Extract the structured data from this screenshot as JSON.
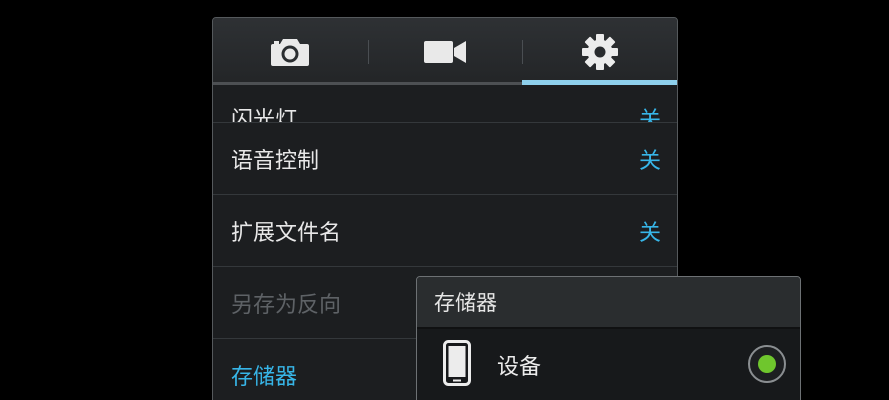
{
  "tabs": [
    {
      "icon": "camera-icon",
      "active": false
    },
    {
      "icon": "video-camera-icon",
      "active": false
    },
    {
      "icon": "gear-icon",
      "active": true
    }
  ],
  "settings": [
    {
      "label": "闪光灯",
      "value": "关",
      "state": "clipped"
    },
    {
      "label": "语音控制",
      "value": "关",
      "state": "normal"
    },
    {
      "label": "扩展文件名",
      "value": "关",
      "state": "normal"
    },
    {
      "label": "另存为反向",
      "value": "",
      "state": "disabled"
    },
    {
      "label": "存储器",
      "value": "",
      "state": "accent"
    }
  ],
  "storage_popup": {
    "title": "存储器",
    "options": [
      {
        "label": "设备",
        "icon": "phone-device-icon",
        "selected": true
      }
    ]
  },
  "colors": {
    "accent": "#37b6e8",
    "radio_selected": "#6fc62d",
    "panel_bg": "#1c1e20"
  }
}
